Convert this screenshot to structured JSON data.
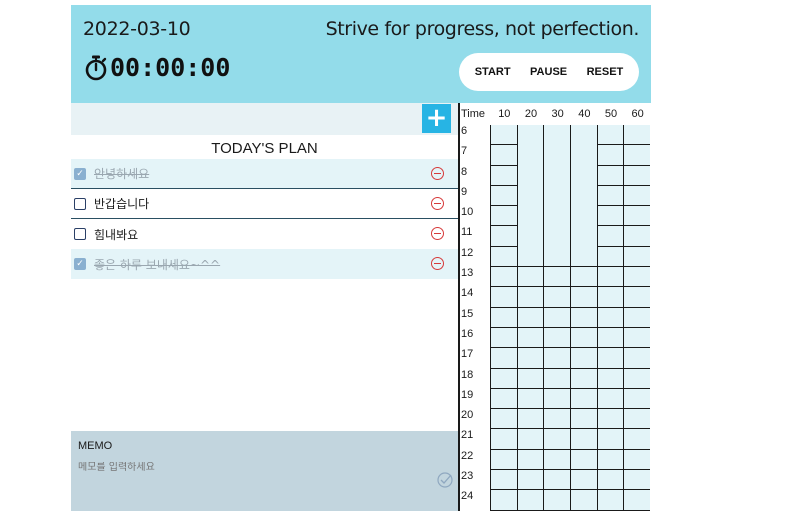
{
  "header": {
    "date": "2022-03-10",
    "quote": "Strive for progress, not perfection.",
    "timer": "00:00:00",
    "buttons": {
      "start": "START",
      "pause": "PAUSE",
      "reset": "RESET"
    },
    "bg_color": "#93dcea"
  },
  "plan": {
    "add_label": "+",
    "title": "TODAY'S PLAN",
    "items": [
      {
        "text": "안녕하세요",
        "done": true
      },
      {
        "text": "반갑습니다",
        "done": false
      },
      {
        "text": "힘내봐요",
        "done": false
      },
      {
        "text": "좋은 하루 보내세요~^^",
        "done": true
      }
    ]
  },
  "memo": {
    "title": "MEMO",
    "placeholder": "메모를 입력하세요"
  },
  "timetable": {
    "header_label": "Time",
    "columns": [
      "10",
      "20",
      "30",
      "40",
      "50",
      "60"
    ],
    "hours": [
      "6",
      "7",
      "8",
      "9",
      "10",
      "11",
      "12",
      "13",
      "14",
      "15",
      "16",
      "17",
      "18",
      "19",
      "20",
      "21",
      "22",
      "23",
      "24"
    ]
  },
  "icons": {
    "stopwatch": "stopwatch-icon",
    "add": "plus-icon",
    "delete": "minus-circle-icon",
    "memo_save": "check-circle-icon"
  },
  "colors": {
    "accent": "#27b4e4",
    "delete": "#d63a3a",
    "memo_bg": "#c2d5de",
    "cell_bg": "#e3f4f8"
  }
}
